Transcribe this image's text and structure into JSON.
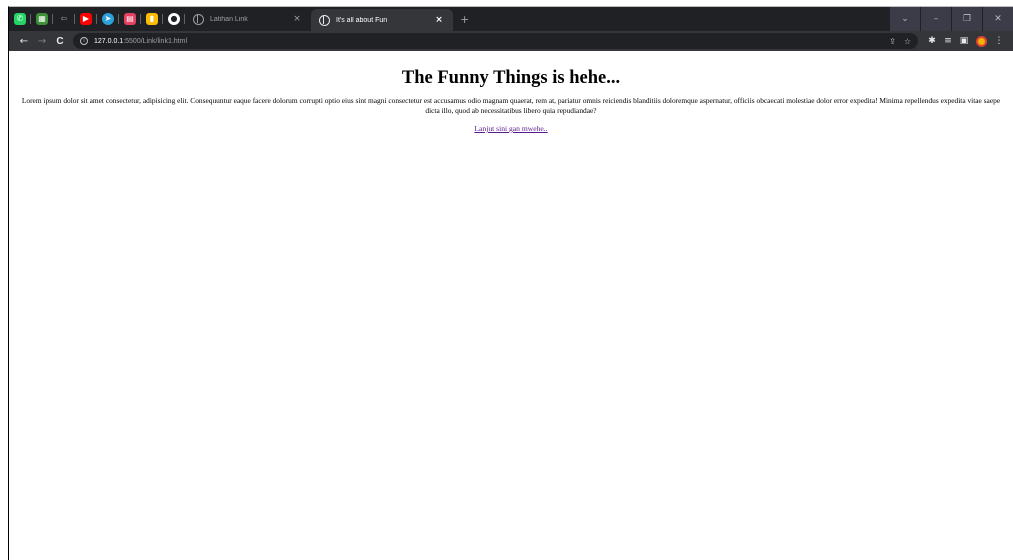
{
  "browser": {
    "pinned_tabs": [
      {
        "icon": "whatsapp-icon",
        "color": "#25d366",
        "glyph": "✆"
      },
      {
        "icon": "spreadsheet-icon",
        "color": "#3f8e3a",
        "glyph": "▦"
      },
      {
        "icon": "back-arrow-icon",
        "color": "#8a8a8a",
        "glyph": "⇦"
      },
      {
        "icon": "youtube-icon",
        "color": "#ff0000",
        "glyph": "▶"
      },
      {
        "icon": "telegram-icon",
        "color": "#2aa1d9",
        "glyph": "➤"
      },
      {
        "icon": "store-icon",
        "color": "#e4405f",
        "glyph": "▤"
      },
      {
        "icon": "keep-icon",
        "color": "#fbbc04",
        "glyph": "▮"
      },
      {
        "icon": "github-icon",
        "color": "#ffffff",
        "glyph": "●"
      }
    ],
    "tabs": [
      {
        "title": "Latihan Link",
        "close": "×",
        "active": false
      },
      {
        "title": "It's all about Fun",
        "close": "×",
        "active": true
      }
    ],
    "new_tab": "+",
    "window_controls": {
      "dropdown": "⌄",
      "minimize": "–",
      "restore": "❐",
      "close": "✕"
    },
    "address": {
      "host": "127.0.0.1",
      "path": ":5500/Link/link1.html"
    },
    "nav": {
      "back": "←",
      "forward": "→",
      "reload": "C"
    },
    "toolbar_icons": {
      "share": "⇪",
      "star": "☆",
      "extensions": "✱",
      "reading_list": "≡",
      "side_panel": "▣",
      "menu": "⋮"
    }
  },
  "page": {
    "heading": "The Funny Things is hehe...",
    "paragraph": "Lorem ipsum dolor sit amet consectetur, adipisicing elit. Consequuntur eaque facere dolorum corrupti optio eius sint magni consectetur est accusamus odio magnam quaerat, rem at, pariatur omnis reiciendis blanditiis doloremque aspernatur, officiis obcaecati molestiae dolor error expedita! Minima repellendus expedita vitae saepe dicta illo, quod ab necessitatibus libero quia repudiandae?",
    "link_text": "Lanjut sini gan mwehe.."
  },
  "colors": {
    "tabstrip_bg": "#202124",
    "toolbar_bg": "#35363a",
    "visited_link": "#551a8b"
  }
}
